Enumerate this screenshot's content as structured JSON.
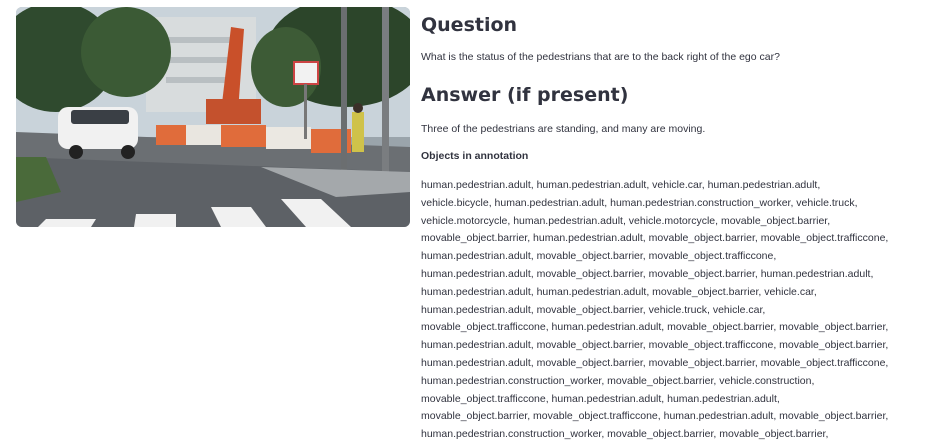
{
  "question": {
    "title": "Question",
    "text": "What is the status of the pedestrians that are to the back right of the ego car?"
  },
  "answer": {
    "title": "Answer (if present)",
    "text": "Three of the pedestrians are standing, and many are moving."
  },
  "objects": {
    "title": "Objects in annotation",
    "lines": [
      "human.pedestrian.adult, human.pedestrian.adult, vehicle.car, human.pedestrian.adult,",
      "vehicle.bicycle, human.pedestrian.adult, human.pedestrian.construction_worker, vehicle.truck,",
      "vehicle.motorcycle, human.pedestrian.adult, vehicle.motorcycle, movable_object.barrier,",
      "movable_object.barrier, human.pedestrian.adult, movable_object.barrier, movable_object.trafficcone,",
      "human.pedestrian.adult, movable_object.barrier, movable_object.trafficcone,",
      "human.pedestrian.adult, movable_object.barrier, movable_object.barrier, human.pedestrian.adult,",
      "human.pedestrian.adult, human.pedestrian.adult, movable_object.barrier, vehicle.car,",
      "human.pedestrian.adult, movable_object.barrier, vehicle.truck, vehicle.car,",
      "movable_object.trafficcone, human.pedestrian.adult, movable_object.barrier, movable_object.barrier,",
      "human.pedestrian.adult, movable_object.barrier, movable_object.trafficcone, movable_object.barrier,",
      "human.pedestrian.adult, movable_object.barrier, movable_object.barrier, movable_object.trafficcone,",
      "human.pedestrian.construction_worker, movable_object.barrier, vehicle.construction,",
      "movable_object.trafficcone, human.pedestrian.adult, human.pedestrian.adult,",
      "movable_object.barrier, movable_object.trafficcone, human.pedestrian.adult, movable_object.barrier,",
      "human.pedestrian.construction_worker, movable_object.barrier, movable_object.barrier,"
    ]
  }
}
